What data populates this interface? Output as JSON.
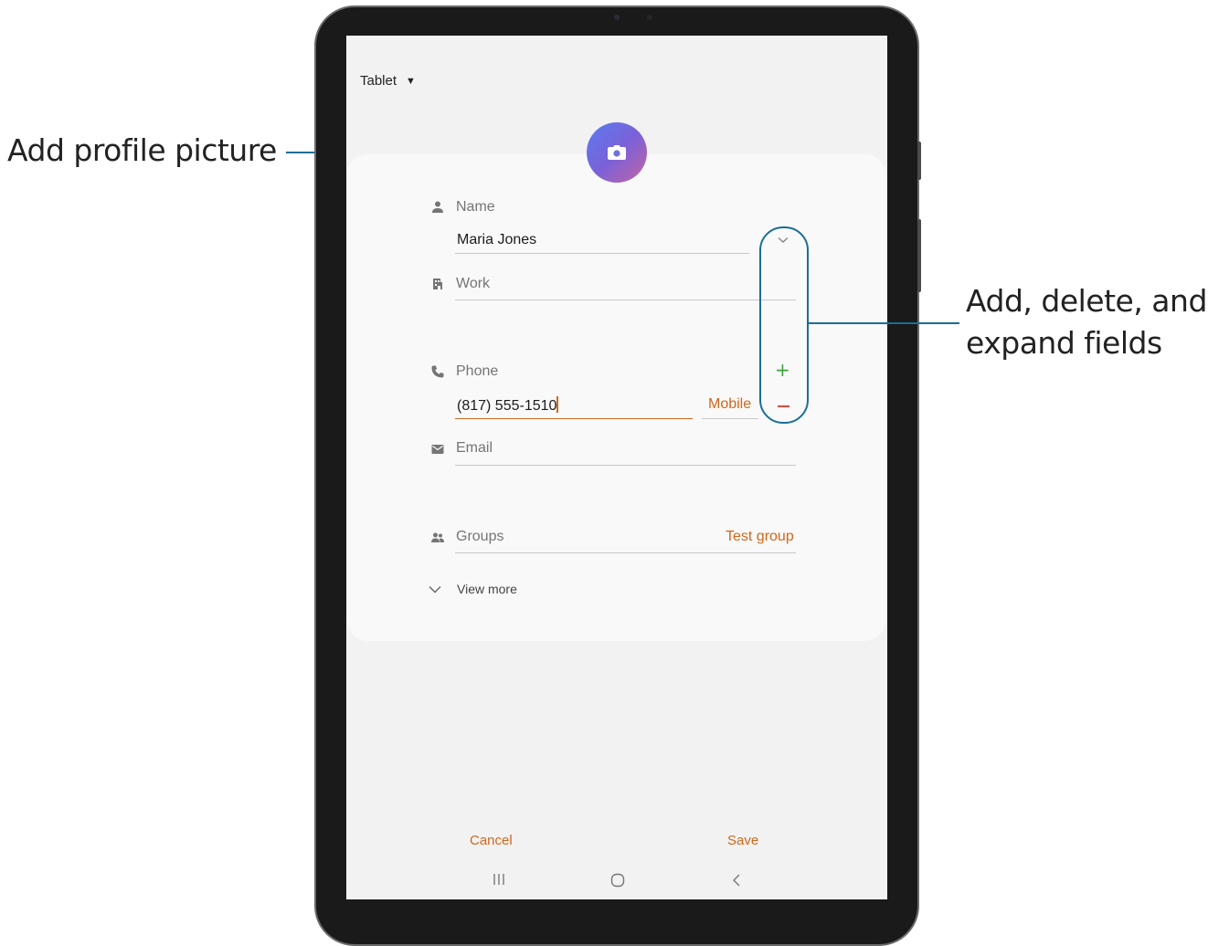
{
  "callouts": {
    "profile_picture": "Add profile picture",
    "fields_line1": "Add, delete, and",
    "fields_line2": "expand fields"
  },
  "header": {
    "account_selector": "Tablet"
  },
  "form": {
    "name": {
      "label": "Name",
      "value": "Maria Jones"
    },
    "work": {
      "label": "Work"
    },
    "phone": {
      "label": "Phone",
      "value": "(817) 555-1510",
      "type": "Mobile"
    },
    "email": {
      "label": "Email"
    },
    "groups": {
      "label": "Groups",
      "value": "Test group"
    },
    "view_more": "View more"
  },
  "actions": {
    "cancel": "Cancel",
    "save": "Save"
  },
  "icons": {
    "avatar": "camera-icon",
    "name": "person-icon",
    "work": "building-icon",
    "phone": "phone-icon",
    "email": "envelope-icon",
    "groups": "people-icon",
    "expand": "chevron-down-icon",
    "add": "plus-icon",
    "remove": "minus-icon",
    "nav_recents": "recents-icon",
    "nav_home": "home-icon",
    "nav_back": "back-icon"
  },
  "colors": {
    "accent": "#d1671b",
    "add_green": "#3fa53a",
    "remove_red": "#e04a3c",
    "callout_blue": "#1a6e96"
  }
}
